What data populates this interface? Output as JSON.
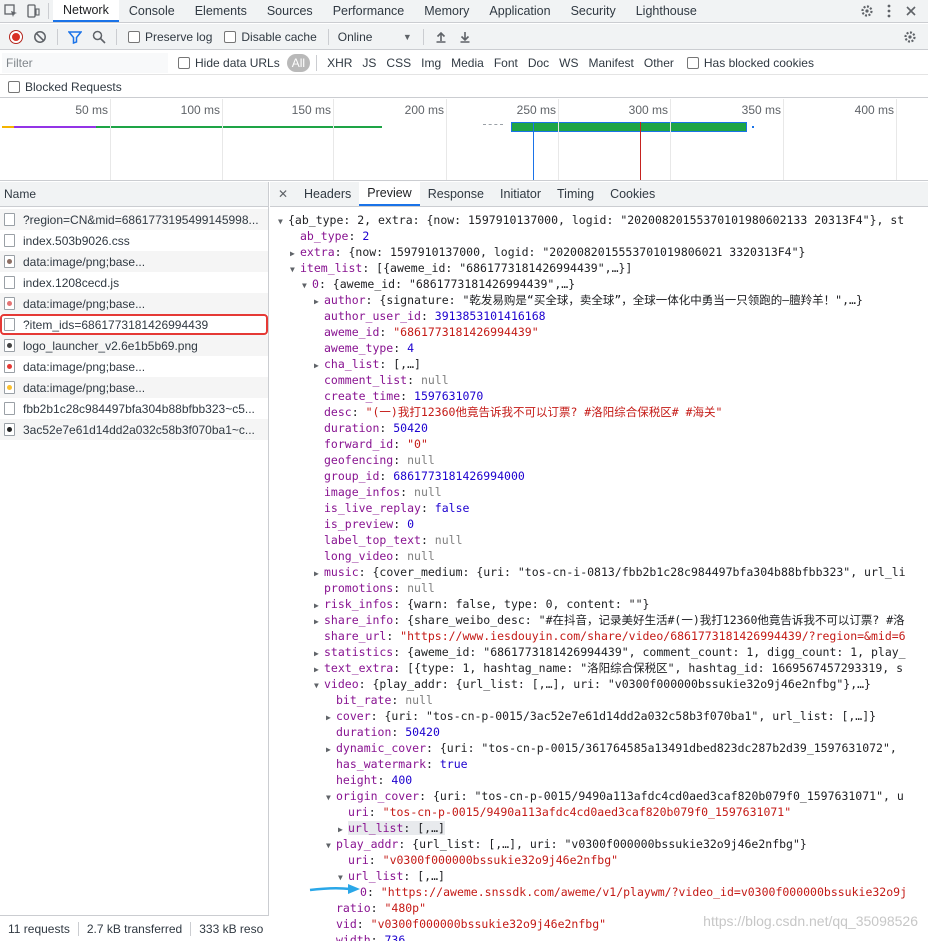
{
  "tabs": [
    "Network",
    "Console",
    "Elements",
    "Sources",
    "Performance",
    "Memory",
    "Application",
    "Security",
    "Lighthouse"
  ],
  "active_tab": "Network",
  "toolbar": {
    "preserve_log": "Preserve log",
    "disable_cache": "Disable cache",
    "throttle": "Online"
  },
  "filterbar": {
    "placeholder": "Filter",
    "hide_data_urls": "Hide data URLs",
    "types": [
      "All",
      "XHR",
      "JS",
      "CSS",
      "Img",
      "Media",
      "Font",
      "Doc",
      "WS",
      "Manifest",
      "Other"
    ],
    "has_blocked_cookies": "Has blocked cookies"
  },
  "blocked_requests": "Blocked Requests",
  "timeline_ticks": [
    "50 ms",
    "100 ms",
    "150 ms",
    "200 ms",
    "250 ms",
    "300 ms",
    "350 ms",
    "400 ms"
  ],
  "name_header": "Name",
  "requests": [
    "?region=CN&mid=6861773195499145998...",
    "index.503b9026.css",
    "data:image/png;base...",
    "index.1208cecd.js",
    "data:image/png;base...",
    "?item_ids=6861773181426994439",
    "logo_launcher_v2.6e1b5b69.png",
    "data:image/png;base...",
    "data:image/png;base...",
    "fbb2b1c28c984497bfa304b88bfbb323~c5...",
    "3ac52e7e61d14dd2a032c58b3f070ba1~c..."
  ],
  "status": {
    "requests": "11 requests",
    "transferred": "2.7 kB transferred",
    "resources": "333 kB reso"
  },
  "detail_tabs": [
    "Headers",
    "Preview",
    "Response",
    "Initiator",
    "Timing",
    "Cookies"
  ],
  "active_detail_tab": "Preview",
  "json_lines": [
    {
      "i": 0,
      "t": "open",
      "k": "",
      "v": "{ab_type: 2, extra: {now: 1597910137000, logid: \"20200820155370101980602133 20313F4\"}, st"
    },
    {
      "i": 1,
      "t": "none",
      "k": "ab_type",
      "v": "2",
      "c": "n"
    },
    {
      "i": 1,
      "t": "closed",
      "k": "extra",
      "v": "{now: 1597910137000, logid: \"2020082015553701019806021 3320313F4\"}",
      "c": "o"
    },
    {
      "i": 1,
      "t": "open",
      "k": "item_list",
      "v": "[{aweme_id: \"6861773181426994439\",…}]",
      "c": "o"
    },
    {
      "i": 2,
      "t": "open",
      "k": "0",
      "v": "{aweme_id: \"6861773181426994439\",…}",
      "c": "o"
    },
    {
      "i": 3,
      "t": "closed",
      "k": "author",
      "v": "{signature: \"乾发易购是“买全球，卖全球”，全球一体化中勇当一只领跑的—膻羚羊！\",…}",
      "c": "o"
    },
    {
      "i": 3,
      "t": "none",
      "k": "author_user_id",
      "v": "3913853101416168",
      "c": "n"
    },
    {
      "i": 3,
      "t": "none",
      "k": "aweme_id",
      "v": "\"6861773181426994439\"",
      "c": "s"
    },
    {
      "i": 3,
      "t": "none",
      "k": "aweme_type",
      "v": "4",
      "c": "n"
    },
    {
      "i": 3,
      "t": "closed",
      "k": "cha_list",
      "v": "[,…]",
      "c": "o"
    },
    {
      "i": 3,
      "t": "none",
      "k": "comment_list",
      "v": "null",
      "c": "nl"
    },
    {
      "i": 3,
      "t": "none",
      "k": "create_time",
      "v": "1597631070",
      "c": "n"
    },
    {
      "i": 3,
      "t": "none",
      "k": "desc",
      "v": "\"(一)我打12360他竟告诉我不可以订票? #洛阳综合保税区# #海关\"",
      "c": "s"
    },
    {
      "i": 3,
      "t": "none",
      "k": "duration",
      "v": "50420",
      "c": "n"
    },
    {
      "i": 3,
      "t": "none",
      "k": "forward_id",
      "v": "\"0\"",
      "c": "s"
    },
    {
      "i": 3,
      "t": "none",
      "k": "geofencing",
      "v": "null",
      "c": "nl"
    },
    {
      "i": 3,
      "t": "none",
      "k": "group_id",
      "v": "6861773181426994000",
      "c": "n"
    },
    {
      "i": 3,
      "t": "none",
      "k": "image_infos",
      "v": "null",
      "c": "nl"
    },
    {
      "i": 3,
      "t": "none",
      "k": "is_live_replay",
      "v": "false",
      "c": "n"
    },
    {
      "i": 3,
      "t": "none",
      "k": "is_preview",
      "v": "0",
      "c": "n"
    },
    {
      "i": 3,
      "t": "none",
      "k": "label_top_text",
      "v": "null",
      "c": "nl"
    },
    {
      "i": 3,
      "t": "none",
      "k": "long_video",
      "v": "null",
      "c": "nl"
    },
    {
      "i": 3,
      "t": "closed",
      "k": "music",
      "v": "{cover_medium: {uri: \"tos-cn-i-0813/fbb2b1c28c984497bfa304b88bfbb323\", url_li",
      "c": "o"
    },
    {
      "i": 3,
      "t": "none",
      "k": "promotions",
      "v": "null",
      "c": "nl"
    },
    {
      "i": 3,
      "t": "closed",
      "k": "risk_infos",
      "v": "{warn: false, type: 0, content: \"\"}",
      "c": "o"
    },
    {
      "i": 3,
      "t": "closed",
      "k": "share_info",
      "v": "{share_weibo_desc: \"#在抖音，记录美好生活#(一)我打12360他竟告诉我不可以订票? #洛",
      "c": "o"
    },
    {
      "i": 3,
      "t": "none",
      "k": "share_url",
      "v": "\"https://www.iesdouyin.com/share/video/6861773181426994439/?region=&mid=6",
      "c": "s"
    },
    {
      "i": 3,
      "t": "closed",
      "k": "statistics",
      "v": "{aweme_id: \"6861773181426994439\", comment_count: 1, digg_count: 1, play_",
      "c": "o"
    },
    {
      "i": 3,
      "t": "closed",
      "k": "text_extra",
      "v": "[{type: 1, hashtag_name: \"洛阳综合保税区\", hashtag_id: 1669567457293319, s",
      "c": "o"
    },
    {
      "i": 3,
      "t": "open",
      "k": "video",
      "v": "{play_addr: {url_list: [,…], uri: \"v0300f000000bssukie32o9j46e2nfbg\"},…}",
      "c": "o"
    },
    {
      "i": 4,
      "t": "none",
      "k": "bit_rate",
      "v": "null",
      "c": "nl"
    },
    {
      "i": 4,
      "t": "closed",
      "k": "cover",
      "v": "{uri: \"tos-cn-p-0015/3ac52e7e61d14dd2a032c58b3f070ba1\", url_list: [,…]}",
      "c": "o"
    },
    {
      "i": 4,
      "t": "none",
      "k": "duration",
      "v": "50420",
      "c": "n"
    },
    {
      "i": 4,
      "t": "closed",
      "k": "dynamic_cover",
      "v": "{uri: \"tos-cn-p-0015/361764585a13491dbed823dc287b2d39_1597631072\",",
      "c": "o"
    },
    {
      "i": 4,
      "t": "none",
      "k": "has_watermark",
      "v": "true",
      "c": "n"
    },
    {
      "i": 4,
      "t": "none",
      "k": "height",
      "v": "400",
      "c": "n"
    },
    {
      "i": 4,
      "t": "open",
      "k": "origin_cover",
      "v": "{uri: \"tos-cn-p-0015/9490a113afdc4cd0aed3caf820b079f0_1597631071\", u",
      "c": "o"
    },
    {
      "i": 5,
      "t": "none",
      "k": "uri",
      "v": "\"tos-cn-p-0015/9490a113afdc4cd0aed3caf820b079f0_1597631071\"",
      "c": "s"
    },
    {
      "i": 5,
      "t": "closed",
      "k": "url_list",
      "v": "[,…]",
      "c": "o",
      "sel": true
    },
    {
      "i": 4,
      "t": "open",
      "k": "play_addr",
      "v": "{url_list: [,…], uri: \"v0300f000000bssukie32o9j46e2nfbg\"}",
      "c": "o"
    },
    {
      "i": 5,
      "t": "none",
      "k": "uri",
      "v": "\"v0300f000000bssukie32o9j46e2nfbg\"",
      "c": "s"
    },
    {
      "i": 5,
      "t": "open",
      "k": "url_list",
      "v": "[,…]",
      "c": "o"
    },
    {
      "i": 6,
      "t": "none",
      "k": "0",
      "v": "\"https://aweme.snssdk.com/aweme/v1/playwm/?video_id=v0300f000000bssukie32o9j",
      "c": "s"
    },
    {
      "i": 4,
      "t": "none",
      "k": "ratio",
      "v": "\"480p\"",
      "c": "s"
    },
    {
      "i": 4,
      "t": "none",
      "k": "vid",
      "v": "\"v0300f000000bssukie32o9j46e2nfbg\"",
      "c": "s"
    },
    {
      "i": 4,
      "t": "none",
      "k": "width",
      "v": "736",
      "c": "n"
    }
  ],
  "watermark": "https://blog.csdn.net/qq_35098526",
  "colors": {
    "accent": "#1a73e8",
    "highlight": "#e53935",
    "arrow": "#2aa7e8"
  }
}
